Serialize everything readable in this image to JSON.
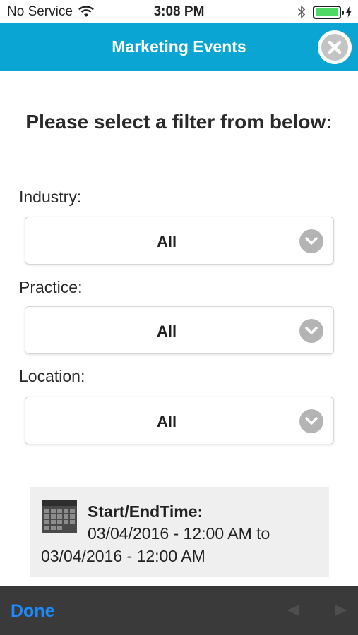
{
  "status_bar": {
    "carrier": "No Service",
    "time": "3:08 PM",
    "battery_color": "#4cd964",
    "icons": [
      "wifi-icon",
      "bluetooth-icon",
      "battery-icon",
      "charging-bolt-icon"
    ]
  },
  "nav": {
    "title": "Marketing Events",
    "background": "#0aa5d2",
    "close_icon": "close-circle-icon"
  },
  "heading": "Please select a filter from below:",
  "filters": [
    {
      "label": "Industry:",
      "value": "All",
      "icon": "chevron-down-circle-icon"
    },
    {
      "label": "Practice:",
      "value": "All",
      "icon": "chevron-down-circle-icon"
    },
    {
      "label": "Location:",
      "value": "All",
      "icon": "chevron-down-circle-icon"
    }
  ],
  "date_range": {
    "label": "Start/EndTime:",
    "start": "03/04/2016 - 12:00 AM to",
    "end": "03/04/2016 - 12:00 AM",
    "icon": "calendar-icon"
  },
  "toolbar": {
    "done_label": "Done",
    "done_color": "#1a8cff",
    "prev_icon": "previous-arrow-icon",
    "next_icon": "next-arrow-icon"
  }
}
